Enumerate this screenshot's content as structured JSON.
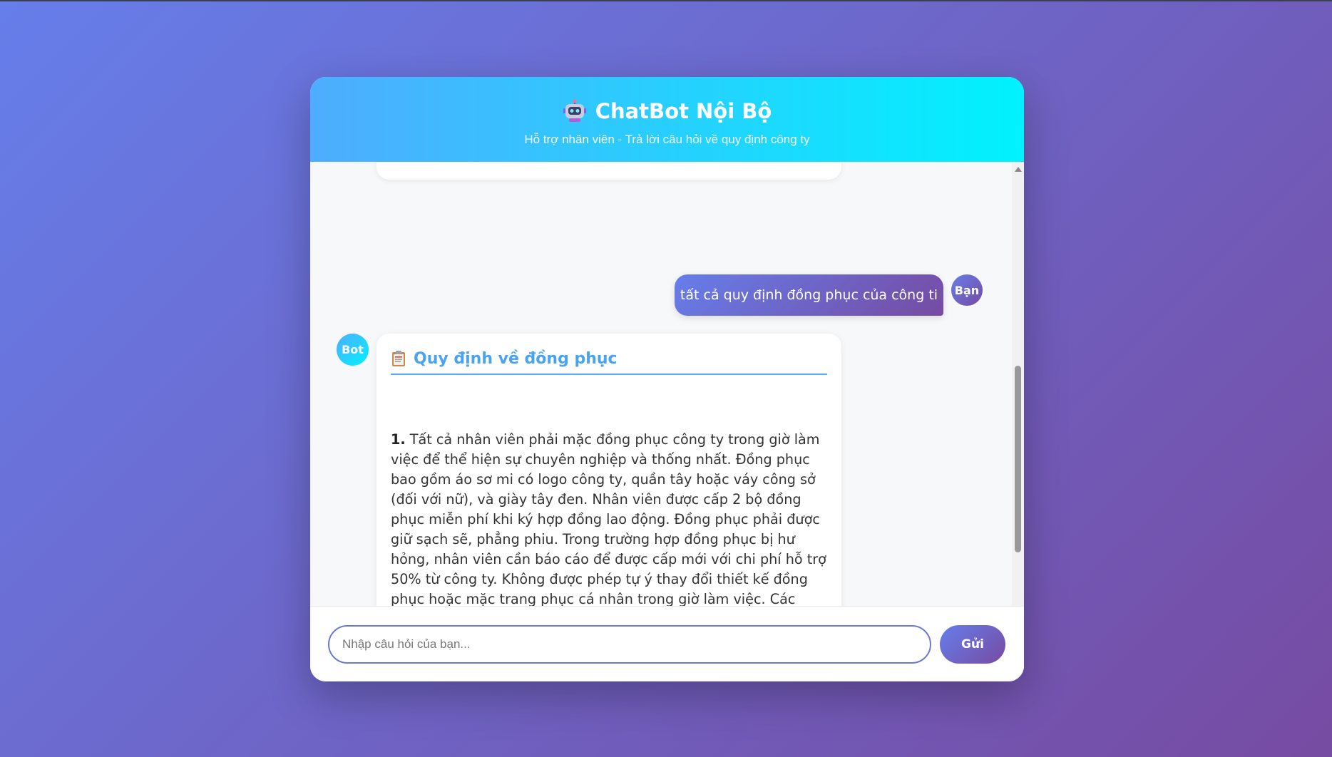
{
  "header": {
    "title": "ChatBot Nội Bộ",
    "subtitle": "Hỗ trợ nhân viên - Trả lời câu hỏi về quy định công ty",
    "icon": "robot-icon"
  },
  "messages": {
    "user_message": {
      "text": "tất cả quy định đồng phục của công ti",
      "avatar_label": "Bạn"
    },
    "bot_message": {
      "avatar_label": "Bot",
      "icon": "clipboard-icon",
      "heading": "Quy định về đồng phục",
      "item_number": "1.",
      "body": "Tất cả nhân viên phải mặc đồng phục công ty trong giờ làm việc để thể hiện sự chuyên nghiệp và thống nhất. Đồng phục bao gồm áo sơ mi có logo công ty, quần tây hoặc váy công sở (đối với nữ), và giày tây đen. Nhân viên được cấp 2 bộ đồng phục miễn phí khi ký hợp đồng lao động. Đồng phục phải được giữ sạch sẽ, phẳng phiu. Trong trường hợp đồng phục bị hư hỏng, nhân viên cần báo cáo để được cấp mới với chi phí hỗ trợ 50% từ công ty. Không được phép tự ý thay đổi thiết kế đồng phục hoặc mặc trang phục cá nhân trong giờ làm việc. Các ngày sự kiện đặc biệt, công ty có thể yêu cầu mặc trang phục theo chủ đề riêng. Quy định này áp dụng cho tất cả nhân viên văn phòng và nhân viên tại các chi nhánh. Nhân viên vi phạm quy định về đồng phục sẽ bị nhắc nhở lần đầu, và có thể bị phạt từ lần thứ hai trở đi. Đồng phục phải được trả lại khi nhân viên nghỉ"
    }
  },
  "composer": {
    "placeholder": "Nhập câu hỏi của bạn...",
    "value": "",
    "send_label": "Gửi"
  },
  "colors": {
    "header_gradient_start": "#4facfe",
    "header_gradient_end": "#00f2fe",
    "user_gradient_start": "#667eea",
    "user_gradient_end": "#764ba2",
    "heading_color": "#4aa3f0"
  }
}
